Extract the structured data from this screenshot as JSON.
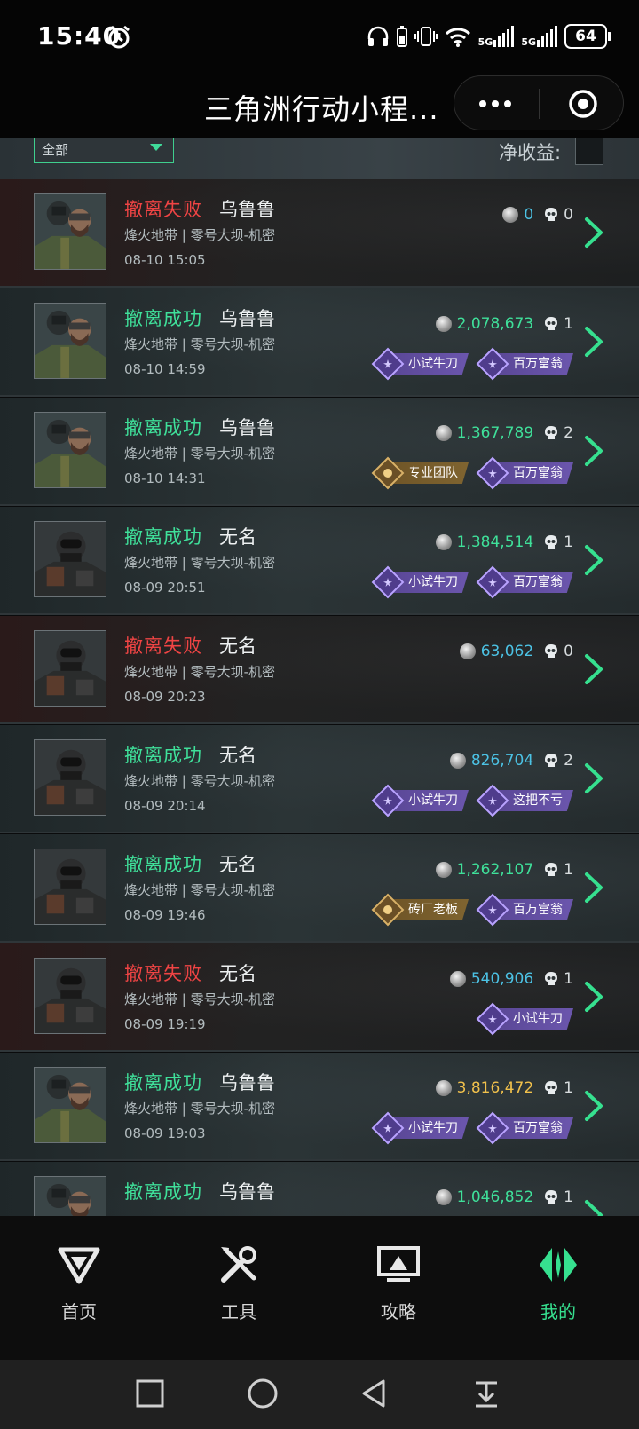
{
  "status_bar": {
    "time": "15:40",
    "network": "5G",
    "battery": "64"
  },
  "title_bar": {
    "title": "三角洲行动小程..."
  },
  "filter": {
    "selected": "全部",
    "net_income_label": "净收益:"
  },
  "records": [
    {
      "status": "撤离失败",
      "result": "fail",
      "player": "乌鲁鲁",
      "mode": "烽火地带 | 零号大坝-机密",
      "time": "08-10 15:05",
      "value": "0",
      "value_color": "cyan",
      "kills": "0",
      "badges": [],
      "avatar": "bearded"
    },
    {
      "status": "撤离成功",
      "result": "success",
      "player": "乌鲁鲁",
      "mode": "烽火地带 | 零号大坝-机密",
      "time": "08-10 14:59",
      "value": "2,078,673",
      "value_color": "green",
      "kills": "1",
      "badges": [
        {
          "label": "小试牛刀",
          "style": "purple"
        },
        {
          "label": "百万富翁",
          "style": "purple"
        }
      ],
      "avatar": "bearded"
    },
    {
      "status": "撤离成功",
      "result": "success",
      "player": "乌鲁鲁",
      "mode": "烽火地带 | 零号大坝-机密",
      "time": "08-10 14:31",
      "value": "1,367,789",
      "value_color": "green",
      "kills": "2",
      "badges": [
        {
          "label": "专业团队",
          "style": "gold"
        },
        {
          "label": "百万富翁",
          "style": "purple"
        }
      ],
      "avatar": "bearded"
    },
    {
      "status": "撤离成功",
      "result": "success",
      "player": "无名",
      "mode": "烽火地带 | 零号大坝-机密",
      "time": "08-09 20:51",
      "value": "1,384,514",
      "value_color": "green",
      "kills": "1",
      "badges": [
        {
          "label": "小试牛刀",
          "style": "purple"
        },
        {
          "label": "百万富翁",
          "style": "purple"
        }
      ],
      "avatar": "masked"
    },
    {
      "status": "撤离失败",
      "result": "fail",
      "player": "无名",
      "mode": "烽火地带 | 零号大坝-机密",
      "time": "08-09 20:23",
      "value": "63,062",
      "value_color": "cyan",
      "kills": "0",
      "badges": [],
      "avatar": "masked"
    },
    {
      "status": "撤离成功",
      "result": "success",
      "player": "无名",
      "mode": "烽火地带 | 零号大坝-机密",
      "time": "08-09 20:14",
      "value": "826,704",
      "value_color": "cyan",
      "kills": "2",
      "badges": [
        {
          "label": "小试牛刀",
          "style": "purple"
        },
        {
          "label": "这把不亏",
          "style": "purple"
        }
      ],
      "avatar": "masked"
    },
    {
      "status": "撤离成功",
      "result": "success",
      "player": "无名",
      "mode": "烽火地带 | 零号大坝-机密",
      "time": "08-09 19:46",
      "value": "1,262,107",
      "value_color": "green",
      "kills": "1",
      "badges": [
        {
          "label": "砖厂老板",
          "style": "gold"
        },
        {
          "label": "百万富翁",
          "style": "purple"
        }
      ],
      "avatar": "masked"
    },
    {
      "status": "撤离失败",
      "result": "fail",
      "player": "无名",
      "mode": "烽火地带 | 零号大坝-机密",
      "time": "08-09 19:19",
      "value": "540,906",
      "value_color": "cyan",
      "kills": "1",
      "badges": [
        {
          "label": "小试牛刀",
          "style": "purple"
        }
      ],
      "avatar": "masked"
    },
    {
      "status": "撤离成功",
      "result": "success",
      "player": "乌鲁鲁",
      "mode": "烽火地带 | 零号大坝-机密",
      "time": "08-09 19:03",
      "value": "3,816,472",
      "value_color": "gold",
      "kills": "1",
      "badges": [
        {
          "label": "小试牛刀",
          "style": "purple"
        },
        {
          "label": "百万富翁",
          "style": "purple"
        }
      ],
      "avatar": "bearded"
    },
    {
      "status": "撤离成功",
      "result": "success",
      "player": "乌鲁鲁",
      "mode": "",
      "time": "",
      "value": "1,046,852",
      "value_color": "green",
      "kills": "1",
      "badges": [],
      "avatar": "bearded"
    }
  ],
  "bottom_nav": [
    {
      "label": "首页",
      "icon": "home-logo-icon",
      "active": false
    },
    {
      "label": "工具",
      "icon": "tools-icon",
      "active": false
    },
    {
      "label": "攻略",
      "icon": "guide-monitor-icon",
      "active": false
    },
    {
      "label": "我的",
      "icon": "profile-logo-icon",
      "active": true
    }
  ],
  "colors": {
    "success": "#3fe09a",
    "fail": "#f04444",
    "value_cyan": "#4cc2e4",
    "value_green": "#3fe09a",
    "value_gold": "#f1c14c",
    "active_nav": "#36e08f"
  }
}
